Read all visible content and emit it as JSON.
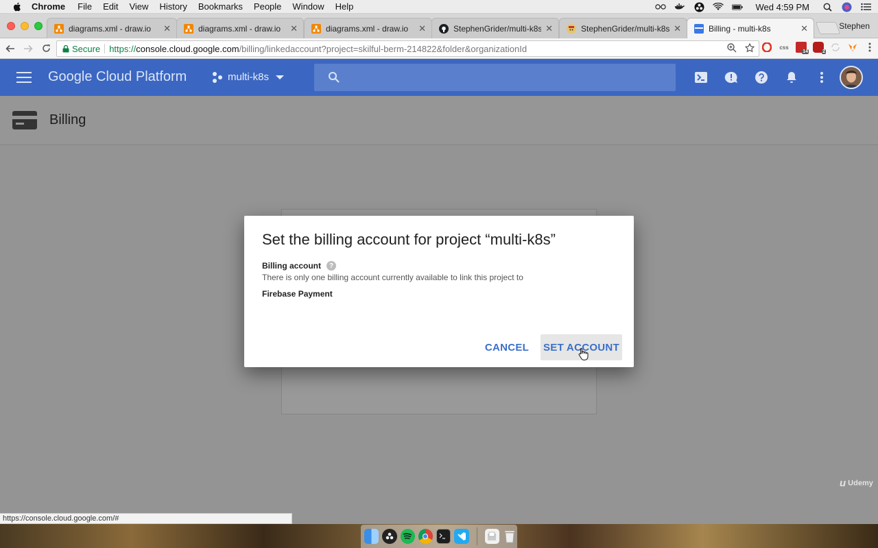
{
  "menubar": {
    "app_name": "Chrome",
    "menus": [
      "File",
      "Edit",
      "View",
      "History",
      "Bookmarks",
      "People",
      "Window",
      "Help"
    ],
    "clock": "Wed 4:59 PM"
  },
  "tabs": [
    {
      "title": "diagrams.xml - draw.io",
      "icon": "drawio-icon",
      "active": false
    },
    {
      "title": "diagrams.xml - draw.io",
      "icon": "drawio-icon",
      "active": false
    },
    {
      "title": "diagrams.xml - draw.io",
      "icon": "drawio-icon",
      "active": false
    },
    {
      "title": "StephenGrider/multi-k8s",
      "icon": "github-icon",
      "active": false
    },
    {
      "title": "StephenGrider/multi-k8s -",
      "icon": "travis-icon",
      "active": false
    },
    {
      "title": "Billing - multi-k8s",
      "icon": "billing-favicon-icon",
      "active": true
    }
  ],
  "profile_name": "Stephen",
  "omnibox": {
    "secure_label": "Secure",
    "url_scheme": "https://",
    "url_host": "console.cloud.google.com",
    "url_path": "/billing/linkedaccount?project=skilful-berm-214822&folder&organizationId"
  },
  "extensions": {
    "css_label": "css",
    "badge_14": "14",
    "badge_2": "2"
  },
  "gcp": {
    "title": "Google Cloud Platform",
    "project": "multi-k8s"
  },
  "page": {
    "title": "Billing"
  },
  "dialog": {
    "title": "Set the billing account for project “multi-k8s”",
    "field_label": "Billing account",
    "help_glyph": "?",
    "field_desc": "There is only one billing account currently available to link this project to",
    "field_value": "Firebase Payment",
    "cancel_label": "CANCEL",
    "confirm_label": "SET ACCOUNT"
  },
  "status_url": "https://console.cloud.google.com/#",
  "watermark": "Udemy",
  "colors": {
    "gcp_header": "#3b67c2",
    "link_blue": "#3b6fc9",
    "secure_green": "#0b8043"
  }
}
